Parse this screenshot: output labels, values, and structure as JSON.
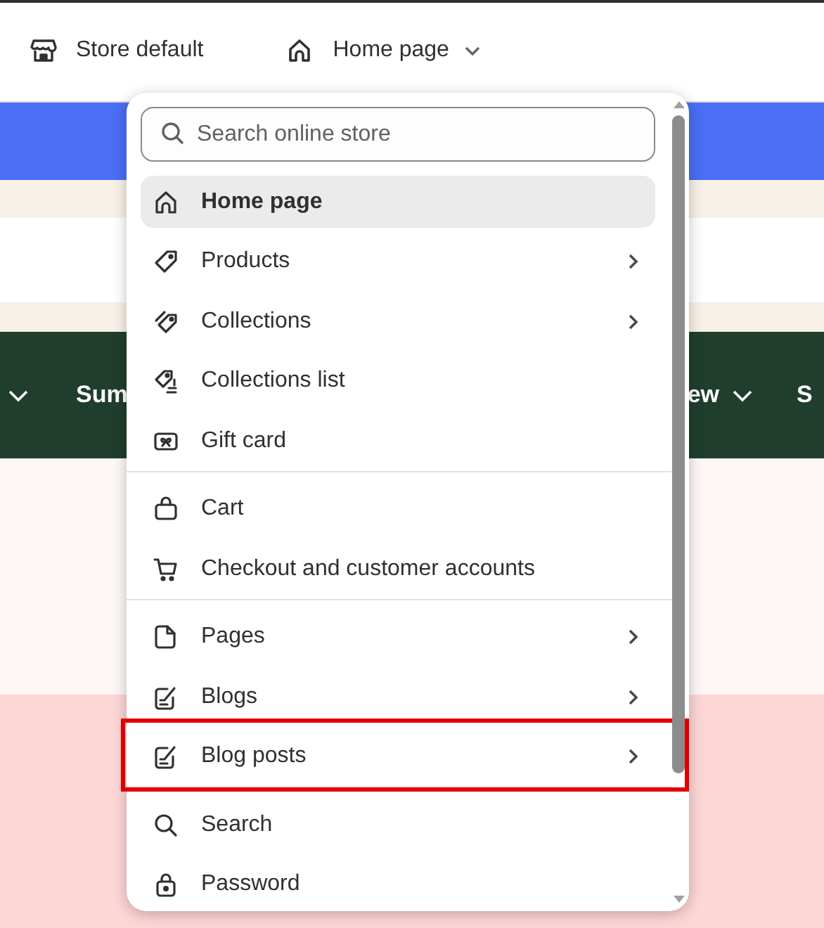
{
  "top_bar": {
    "store": "Store default",
    "page_selector": "Home page"
  },
  "background": {
    "nav_items": [
      "Sum",
      "ew",
      "S"
    ]
  },
  "dropdown": {
    "search": {
      "placeholder": "Search online store"
    },
    "groups": [
      [
        {
          "label": "Home page",
          "selected": true,
          "submenu": false,
          "highlighted": false
        },
        {
          "label": "Products",
          "selected": false,
          "submenu": true,
          "highlighted": false
        },
        {
          "label": "Collections",
          "selected": false,
          "submenu": true,
          "highlighted": false
        },
        {
          "label": "Collections list",
          "selected": false,
          "submenu": false,
          "highlighted": false
        },
        {
          "label": "Gift card",
          "selected": false,
          "submenu": false,
          "highlighted": false
        }
      ],
      [
        {
          "label": "Cart",
          "selected": false,
          "submenu": false,
          "highlighted": false
        },
        {
          "label": "Checkout and customer accounts",
          "selected": false,
          "submenu": false,
          "highlighted": false
        }
      ],
      [
        {
          "label": "Pages",
          "selected": false,
          "submenu": true,
          "highlighted": false
        },
        {
          "label": "Blogs",
          "selected": false,
          "submenu": true,
          "highlighted": false
        },
        {
          "label": "Blog posts",
          "selected": false,
          "submenu": true,
          "highlighted": true
        }
      ],
      [
        {
          "label": "Search",
          "selected": false,
          "submenu": false,
          "highlighted": false
        },
        {
          "label": "Password",
          "selected": false,
          "submenu": false,
          "highlighted": false
        }
      ]
    ]
  }
}
